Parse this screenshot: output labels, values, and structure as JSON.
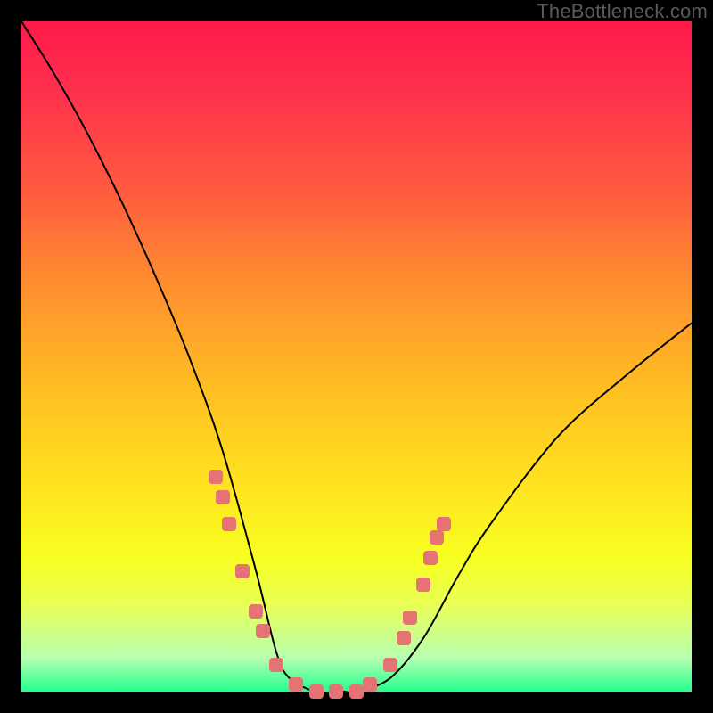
{
  "watermark": {
    "text": "TheBottleneck.com"
  },
  "chart_data": {
    "type": "line",
    "title": "",
    "xlabel": "",
    "ylabel": "",
    "xlim": [
      0,
      100
    ],
    "ylim": [
      0,
      100
    ],
    "series": [
      {
        "name": "bottleneck-curve",
        "x": [
          0,
          5,
          10,
          15,
          20,
          25,
          30,
          35,
          38,
          40,
          44,
          48,
          50,
          55,
          60,
          65,
          70,
          80,
          90,
          100
        ],
        "y": [
          100,
          92,
          83,
          73,
          62,
          50,
          36,
          18,
          6,
          2,
          0,
          0,
          0,
          2,
          8,
          17,
          25,
          38,
          47,
          55
        ]
      }
    ],
    "markers": {
      "name": "highlighted-points",
      "color": "#e57373",
      "points": [
        {
          "x": 29,
          "y": 32
        },
        {
          "x": 30,
          "y": 29
        },
        {
          "x": 31,
          "y": 25
        },
        {
          "x": 33,
          "y": 18
        },
        {
          "x": 35,
          "y": 12
        },
        {
          "x": 36,
          "y": 9
        },
        {
          "x": 38,
          "y": 4
        },
        {
          "x": 41,
          "y": 1
        },
        {
          "x": 44,
          "y": 0
        },
        {
          "x": 47,
          "y": 0
        },
        {
          "x": 50,
          "y": 0
        },
        {
          "x": 52,
          "y": 1
        },
        {
          "x": 55,
          "y": 4
        },
        {
          "x": 57,
          "y": 8
        },
        {
          "x": 58,
          "y": 11
        },
        {
          "x": 60,
          "y": 16
        },
        {
          "x": 61,
          "y": 20
        },
        {
          "x": 62,
          "y": 23
        },
        {
          "x": 63,
          "y": 25
        }
      ]
    },
    "grid": false,
    "legend": false
  },
  "colors": {
    "gradient_top": "#ff1a4a",
    "gradient_bottom": "#23ff8f",
    "curve": "#000000",
    "marker": "#e57373",
    "frame": "#000000"
  }
}
